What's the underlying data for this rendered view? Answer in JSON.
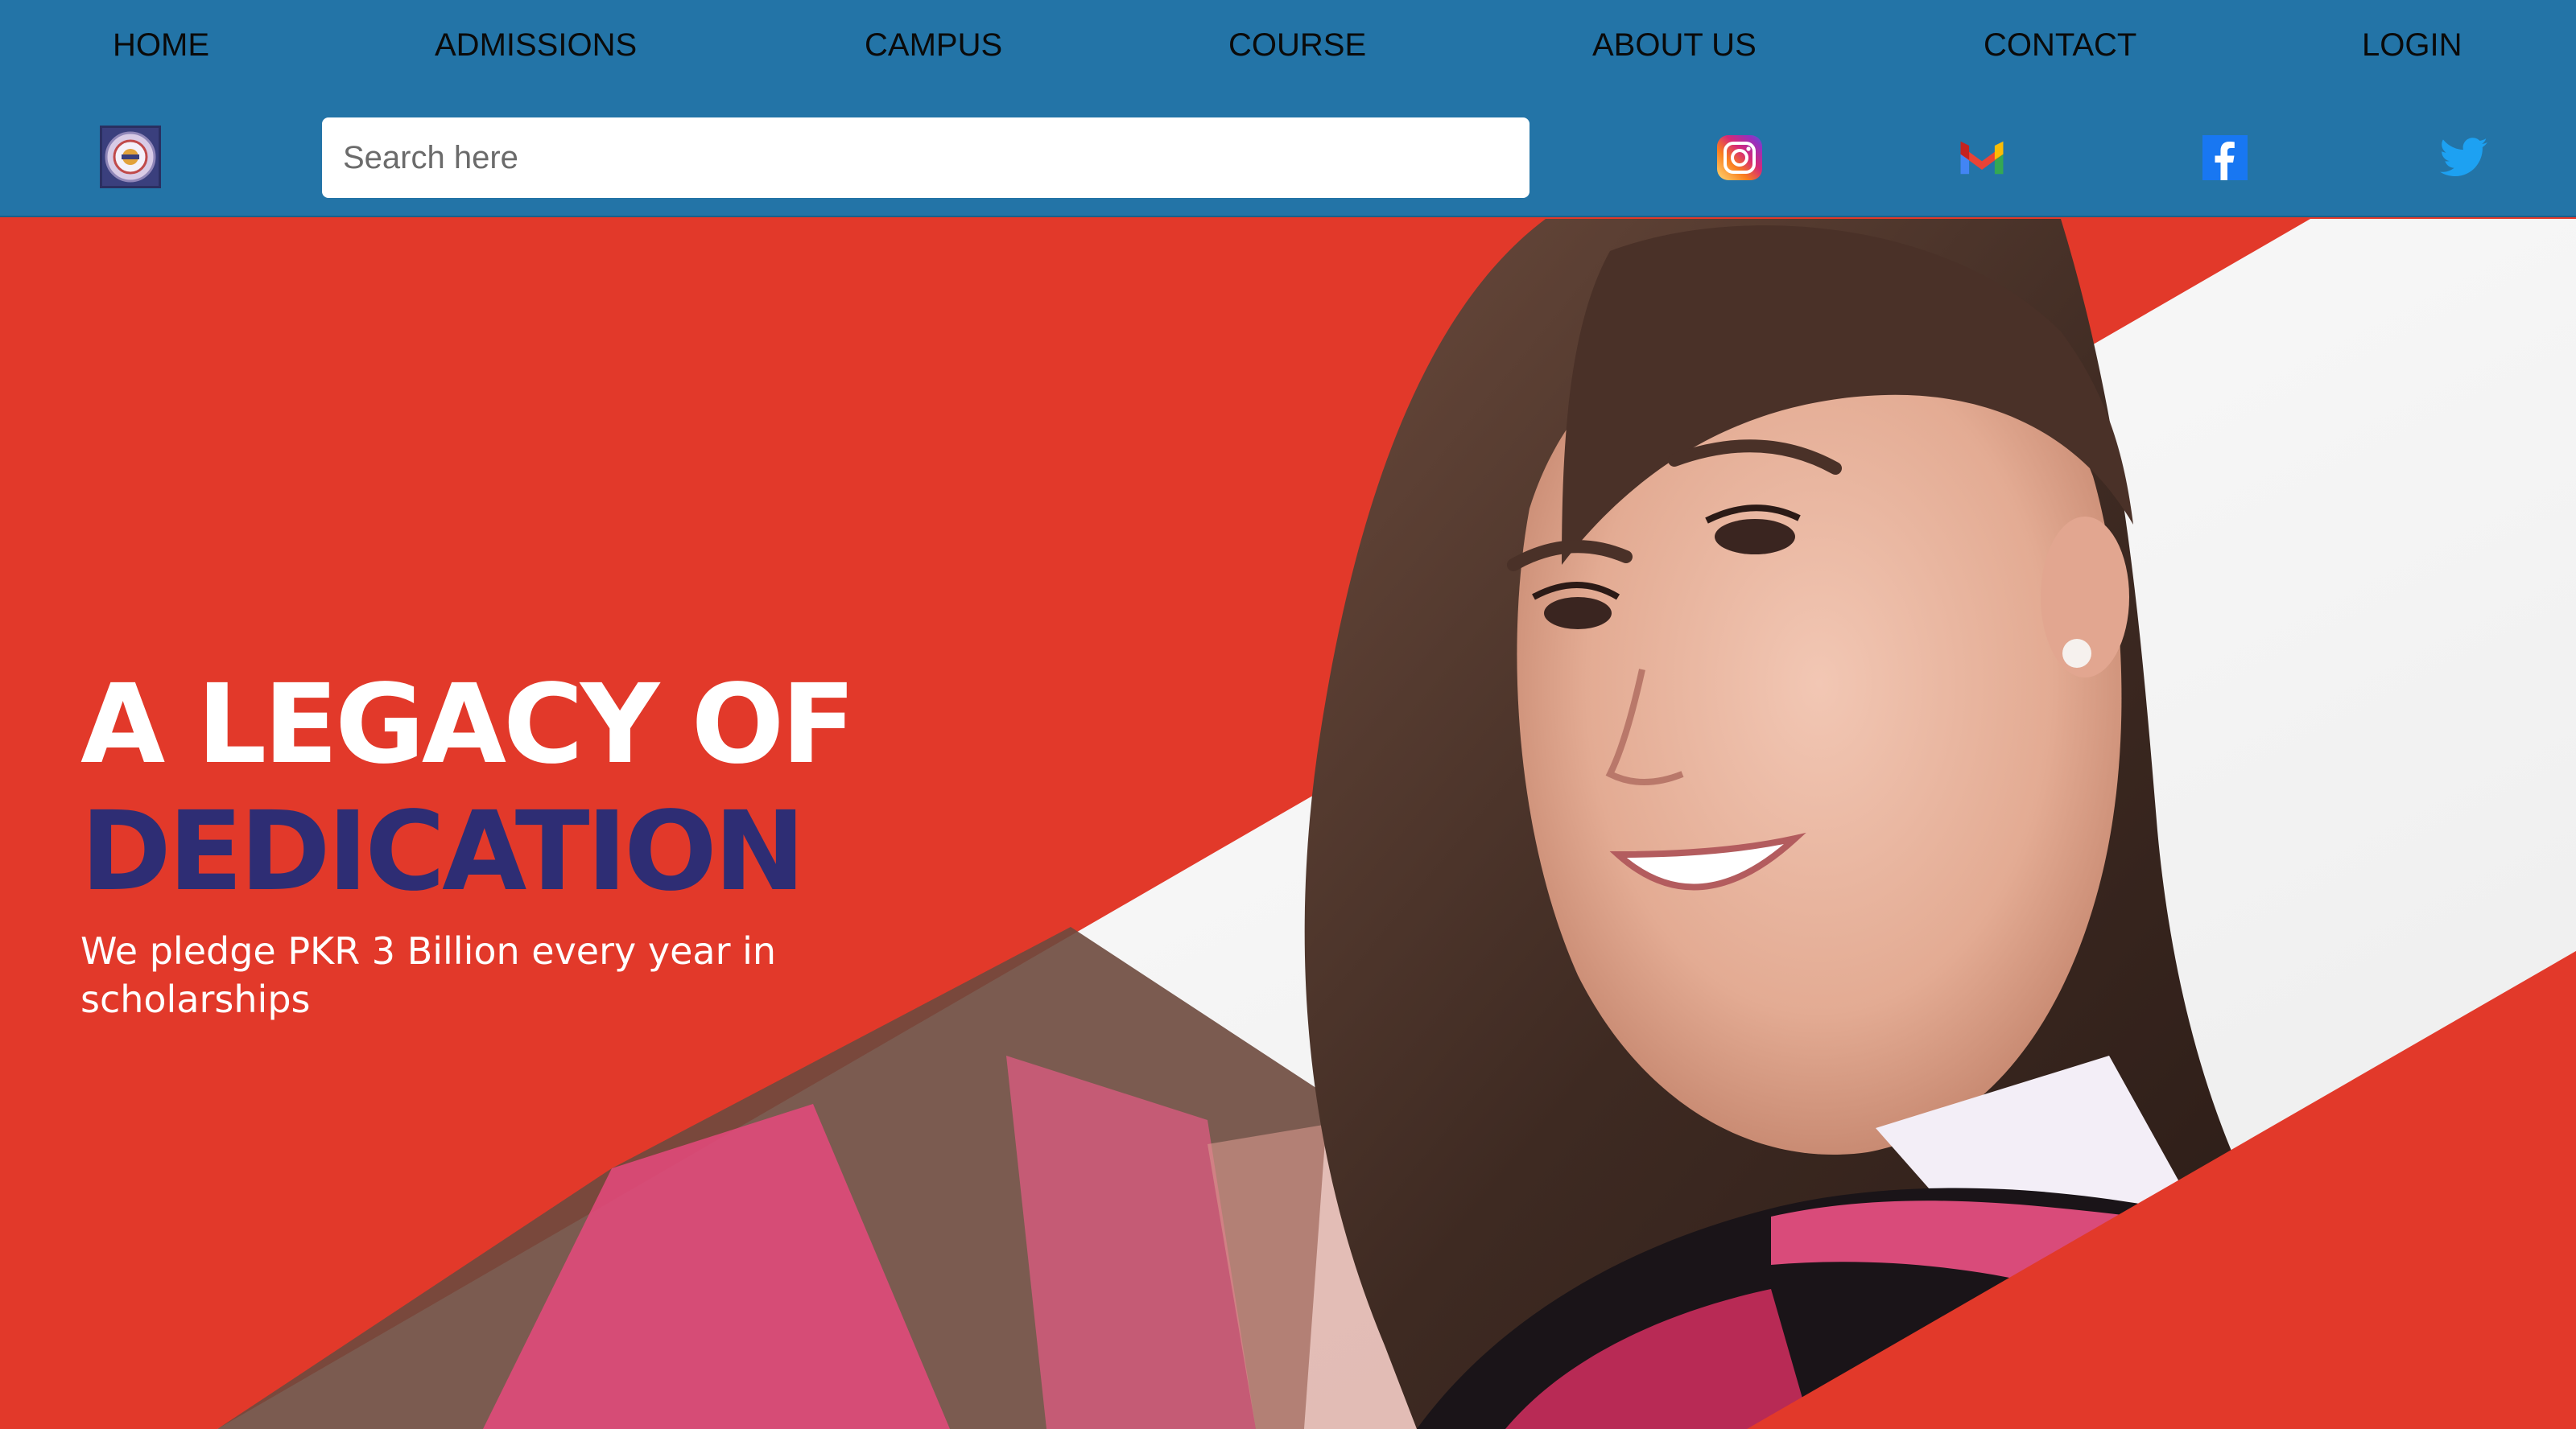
{
  "nav": {
    "items": [
      {
        "label": "HOME"
      },
      {
        "label": "ADMISSIONS"
      },
      {
        "label": "CAMPUS"
      },
      {
        "label": "COURSE"
      },
      {
        "label": "ABOUT US"
      },
      {
        "label": "CONTACT"
      },
      {
        "label": "LOGIN"
      }
    ]
  },
  "search": {
    "placeholder": "Search here",
    "value": ""
  },
  "social": {
    "items": [
      {
        "icon": "instagram-icon"
      },
      {
        "icon": "gmail-icon"
      },
      {
        "icon": "facebook-icon"
      },
      {
        "icon": "twitter-icon"
      }
    ]
  },
  "hero": {
    "title_line1": "A LEGACY OF",
    "title_line2": "DEDICATION",
    "subtitle": "We pledge PKR 3 Billion every year in scholarships"
  },
  "colors": {
    "header_bg": "#2374a7",
    "hero_bg": "#e2392a",
    "title_accent": "#2e2d74",
    "nav_text": "#0a0a0a"
  }
}
